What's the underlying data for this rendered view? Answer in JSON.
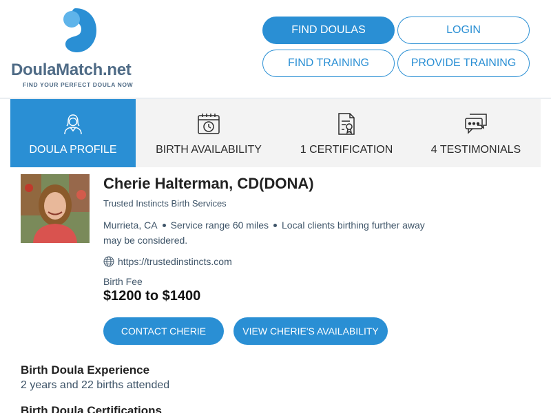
{
  "brand": {
    "name": "DoulaMatch.net",
    "tagline": "FIND YOUR PERFECT DOULA NOW",
    "colors": {
      "primary": "#2a8fd4",
      "text_dark": "#222222",
      "text_muted": "#3e5468",
      "logo_text": "#4f6b86"
    }
  },
  "nav": {
    "find_doulas": "FIND DOULAS",
    "login": "LOGIN",
    "find_training": "FIND TRAINING",
    "provide_training": "PROVIDE TRAINING"
  },
  "tabs": [
    {
      "label": "DOULA PROFILE",
      "icon": "person-icon",
      "active": true
    },
    {
      "label": "BIRTH AVAILABILITY",
      "icon": "calendar-clock-icon",
      "active": false
    },
    {
      "label": "1 CERTIFICATION",
      "icon": "certificate-icon",
      "active": false
    },
    {
      "label": "4 TESTIMONIALS",
      "icon": "chat-bubbles-icon",
      "active": false
    }
  ],
  "profile": {
    "name": "Cherie Halterman, CD(DONA)",
    "business": "Trusted Instincts Birth Services",
    "location": "Murrieta, CA",
    "service_range": "Service range 60 miles",
    "note": "Local clients birthing further away may be considered.",
    "website": "https://trustedinstincts.com",
    "fee_label": "Birth Fee",
    "fee_value": "$1200 to $1400",
    "contact_button": "CONTACT CHERIE",
    "availability_button": "VIEW CHERIE'S AVAILABILITY"
  },
  "sections": {
    "experience_title": "Birth Doula Experience",
    "experience_text": "2 years and 22 births attended",
    "certifications_title": "Birth Doula Certifications"
  }
}
